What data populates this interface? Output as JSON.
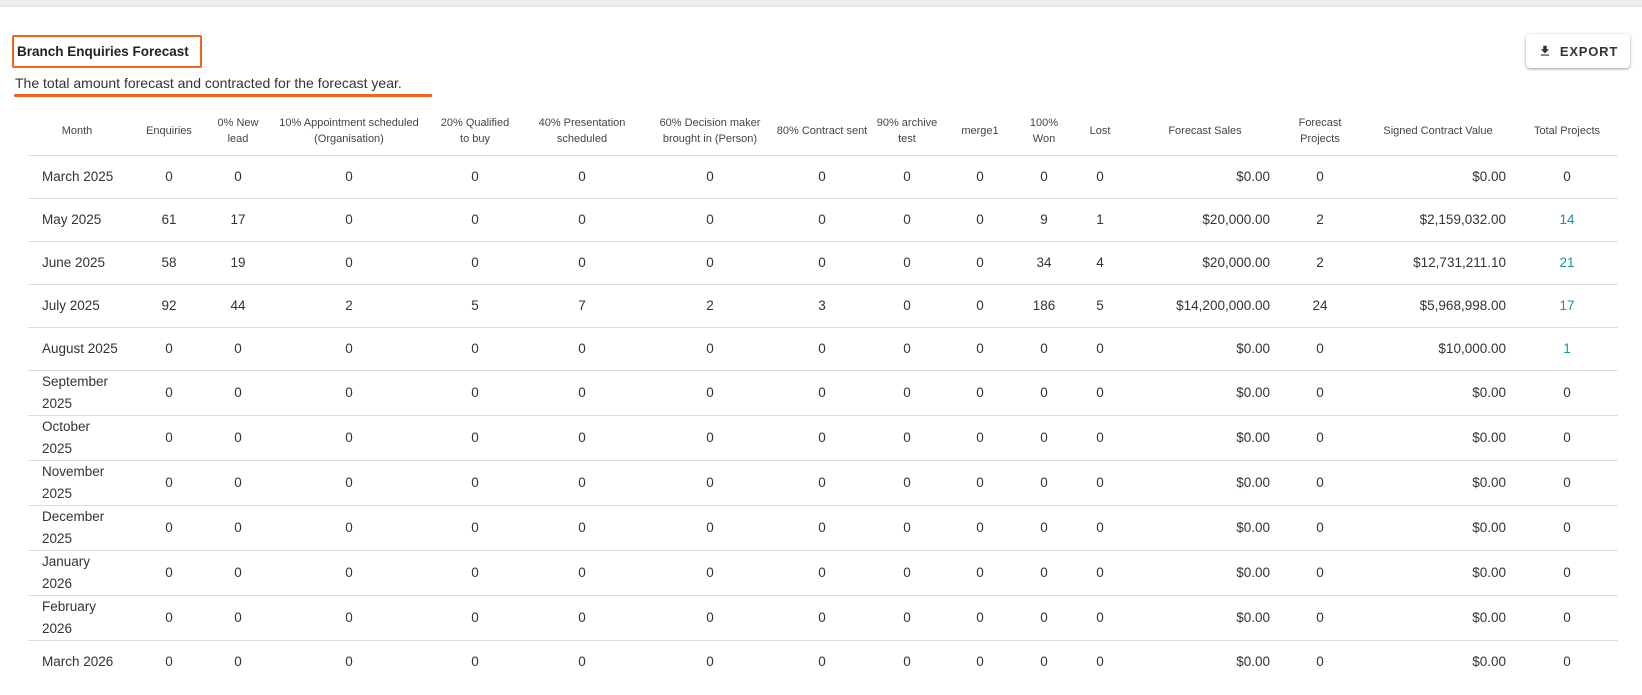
{
  "header": {
    "title": "Branch Enquiries Forecast",
    "subtitle": "The total amount forecast and contracted for the forecast year.",
    "export_label": "EXPORT",
    "export_icon": "download-icon"
  },
  "colors": {
    "highlight": "#f0651f",
    "link": "#1a8fa8"
  },
  "table": {
    "columns": [
      "Month",
      "Enquiries",
      "0% New lead",
      "10% Appointment scheduled (Organisation)",
      "20% Qualified to buy",
      "40% Presentation scheduled",
      "60% Decision maker brought in (Person)",
      "80% Contract sent",
      "90% archive test",
      "merge1",
      "100% Won",
      "Lost",
      "Forecast Sales",
      "Forecast Projects",
      "Signed Contract Value",
      "Total Projects"
    ],
    "rows": [
      [
        "March 2025",
        "0",
        "0",
        "0",
        "0",
        "0",
        "0",
        "0",
        "0",
        "0",
        "0",
        "0",
        "$0.00",
        "0",
        "$0.00",
        "0"
      ],
      [
        "May 2025",
        "61",
        "17",
        "0",
        "0",
        "0",
        "0",
        "0",
        "0",
        "0",
        "9",
        "1",
        "$20,000.00",
        "2",
        "$2,159,032.00",
        "14"
      ],
      [
        "June 2025",
        "58",
        "19",
        "0",
        "0",
        "0",
        "0",
        "0",
        "0",
        "0",
        "34",
        "4",
        "$20,000.00",
        "2",
        "$12,731,211.10",
        "21"
      ],
      [
        "July 2025",
        "92",
        "44",
        "2",
        "5",
        "7",
        "2",
        "3",
        "0",
        "0",
        "186",
        "5",
        "$14,200,000.00",
        "24",
        "$5,968,998.00",
        "17"
      ],
      [
        "August 2025",
        "0",
        "0",
        "0",
        "0",
        "0",
        "0",
        "0",
        "0",
        "0",
        "0",
        "0",
        "$0.00",
        "0",
        "$10,000.00",
        "1"
      ],
      [
        "September 2025",
        "0",
        "0",
        "0",
        "0",
        "0",
        "0",
        "0",
        "0",
        "0",
        "0",
        "0",
        "$0.00",
        "0",
        "$0.00",
        "0"
      ],
      [
        "October 2025",
        "0",
        "0",
        "0",
        "0",
        "0",
        "0",
        "0",
        "0",
        "0",
        "0",
        "0",
        "$0.00",
        "0",
        "$0.00",
        "0"
      ],
      [
        "November 2025",
        "0",
        "0",
        "0",
        "0",
        "0",
        "0",
        "0",
        "0",
        "0",
        "0",
        "0",
        "$0.00",
        "0",
        "$0.00",
        "0"
      ],
      [
        "December 2025",
        "0",
        "0",
        "0",
        "0",
        "0",
        "0",
        "0",
        "0",
        "0",
        "0",
        "0",
        "$0.00",
        "0",
        "$0.00",
        "0"
      ],
      [
        "January 2026",
        "0",
        "0",
        "0",
        "0",
        "0",
        "0",
        "0",
        "0",
        "0",
        "0",
        "0",
        "$0.00",
        "0",
        "$0.00",
        "0"
      ],
      [
        "February 2026",
        "0",
        "0",
        "0",
        "0",
        "0",
        "0",
        "0",
        "0",
        "0",
        "0",
        "0",
        "$0.00",
        "0",
        "$0.00",
        "0"
      ],
      [
        "March 2026",
        "0",
        "0",
        "0",
        "0",
        "0",
        "0",
        "0",
        "0",
        "0",
        "0",
        "0",
        "$0.00",
        "0",
        "$0.00",
        "0"
      ]
    ],
    "linked_total_projects": [
      false,
      true,
      true,
      true,
      true,
      false,
      false,
      false,
      false,
      false,
      false,
      false
    ]
  }
}
